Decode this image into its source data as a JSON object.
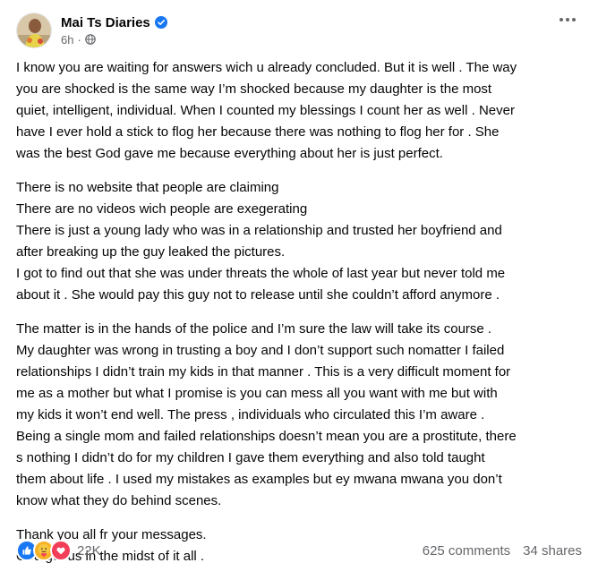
{
  "post": {
    "author": "Mai Ts Diaries",
    "time": "6h",
    "meta_separator": "·",
    "privacy_icon": "globe-icon",
    "verified_icon": "verified-badge-icon",
    "more_icon": "more-options-icon",
    "paragraphs": [
      {
        "lines": [
          "I know you are waiting for answers wich u already concluded. But it is well . The way",
          "you are shocked is the same way I’m shocked because my daughter is the most",
          "quiet, intelligent, individual. When I counted my blessings I count her as well . Never",
          "have I ever hold a stick to flog her because there was nothing to flog her for . She",
          "was the best God gave me because everything about her is just perfect."
        ]
      },
      {
        "lines": [
          "There is no website that people are claiming",
          "There are no videos wich people are exegerating",
          "There is just a young lady who was in a relationship and trusted her boyfriend and",
          "after breaking up the guy leaked the pictures.",
          "I got to find out that she was under threats the whole of last year but never told me",
          "about it . She would pay this guy not to release until she couldn’t afford anymore ."
        ]
      },
      {
        "lines": [
          "The matter is in the hands of the police and I’m sure the law will take its course .",
          "My daughter was wrong in trusting a boy and I don’t support such nomatter I failed",
          "relationships I didn’t train my kids in that manner . This is a very difficult moment for",
          "me as a mother but what I promise is you can mess all you want with me but with",
          "my kids it won’t end well. The press , individuals who circulated this I’m aware .",
          "Being a single mom and failed relationships doesn’t mean you are a prostitute, there",
          "s nothing I didn’t do for my children I gave them everything and also told taught",
          "them about life . I used my mistakes as examples but ey mwana mwana you don’t",
          "know what they do behind scenes."
        ]
      },
      {
        "lines": [
          "Thank you all fr your messages.",
          "God got us in the midst of it all ."
        ]
      }
    ],
    "reactions": {
      "icons": [
        "like-reaction-icon",
        "care-reaction-icon",
        "love-reaction-icon"
      ],
      "count": "22K"
    },
    "comments": "625 comments",
    "shares": "34 shares",
    "colors": {
      "like": "#1877f2",
      "care": "#f7b125",
      "love": "#f33e58",
      "secondary_text": "#65676b"
    }
  }
}
